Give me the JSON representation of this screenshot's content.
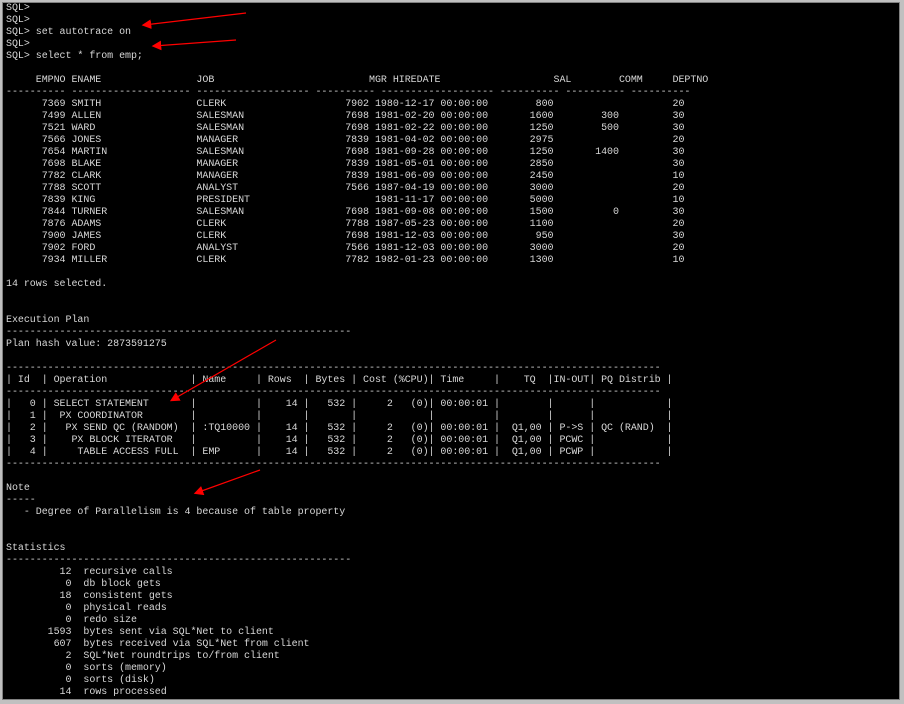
{
  "terminal": {
    "lines": [
      "SQL>",
      "SQL>",
      "SQL> set autotrace on",
      "SQL>",
      "SQL> select * from emp;",
      "",
      "     EMPNO ENAME                JOB                          MGR HIREDATE                   SAL        COMM     DEPTNO",
      "---------- -------------------- ------------------- ---------- ------------------- ---------- ---------- ----------",
      "      7369 SMITH                CLERK                    7902 1980-12-17 00:00:00        800                    20",
      "      7499 ALLEN                SALESMAN                 7698 1981-02-20 00:00:00       1600        300         30",
      "      7521 WARD                 SALESMAN                 7698 1981-02-22 00:00:00       1250        500         30",
      "      7566 JONES                MANAGER                  7839 1981-04-02 00:00:00       2975                    20",
      "      7654 MARTIN               SALESMAN                 7698 1981-09-28 00:00:00       1250       1400         30",
      "      7698 BLAKE                MANAGER                  7839 1981-05-01 00:00:00       2850                    30",
      "      7782 CLARK                MANAGER                  7839 1981-06-09 00:00:00       2450                    10",
      "      7788 SCOTT                ANALYST                  7566 1987-04-19 00:00:00       3000                    20",
      "      7839 KING                 PRESIDENT                     1981-11-17 00:00:00       5000                    10",
      "      7844 TURNER               SALESMAN                 7698 1981-09-08 00:00:00       1500          0         30",
      "      7876 ADAMS                CLERK                    7788 1987-05-23 00:00:00       1100                    20",
      "      7900 JAMES                CLERK                    7698 1981-12-03 00:00:00        950                    30",
      "      7902 FORD                 ANALYST                  7566 1981-12-03 00:00:00       3000                    20",
      "      7934 MILLER               CLERK                    7782 1982-01-23 00:00:00       1300                    10",
      "",
      "14 rows selected.",
      "",
      "",
      "Execution Plan",
      "----------------------------------------------------------",
      "Plan hash value: 2873591275",
      "",
      "--------------------------------------------------------------------------------------------------------------",
      "| Id  | Operation              | Name     | Rows  | Bytes | Cost (%CPU)| Time     |    TQ  |IN-OUT| PQ Distrib |",
      "--------------------------------------------------------------------------------------------------------------",
      "|   0 | SELECT STATEMENT       |          |    14 |   532 |     2   (0)| 00:00:01 |        |      |            |",
      "|   1 |  PX COORDINATOR        |          |       |       |            |          |        |      |            |",
      "|   2 |   PX SEND QC (RANDOM)  | :TQ10000 |    14 |   532 |     2   (0)| 00:00:01 |  Q1,00 | P->S | QC (RAND)  |",
      "|   3 |    PX BLOCK ITERATOR   |          |    14 |   532 |     2   (0)| 00:00:01 |  Q1,00 | PCWC |            |",
      "|   4 |     TABLE ACCESS FULL  | EMP      |    14 |   532 |     2   (0)| 00:00:01 |  Q1,00 | PCWP |            |",
      "--------------------------------------------------------------------------------------------------------------",
      "",
      "Note",
      "-----",
      "   - Degree of Parallelism is 4 because of table property",
      "",
      "",
      "Statistics",
      "----------------------------------------------------------",
      "         12  recursive calls",
      "          0  db block gets",
      "         18  consistent gets",
      "          0  physical reads",
      "          0  redo size",
      "       1593  bytes sent via SQL*Net to client",
      "        607  bytes received via SQL*Net from client",
      "          2  SQL*Net roundtrips to/from client",
      "          0  sorts (memory)",
      "          0  sorts (disk)",
      "         14  rows processed"
    ],
    "colors": {
      "background": "#000000",
      "text": "#d8d8d8",
      "annotation": "#ff0000"
    }
  },
  "annotations": [
    "arrow-autotrace",
    "arrow-select",
    "arrow-px-coordinator",
    "arrow-dop-note"
  ]
}
